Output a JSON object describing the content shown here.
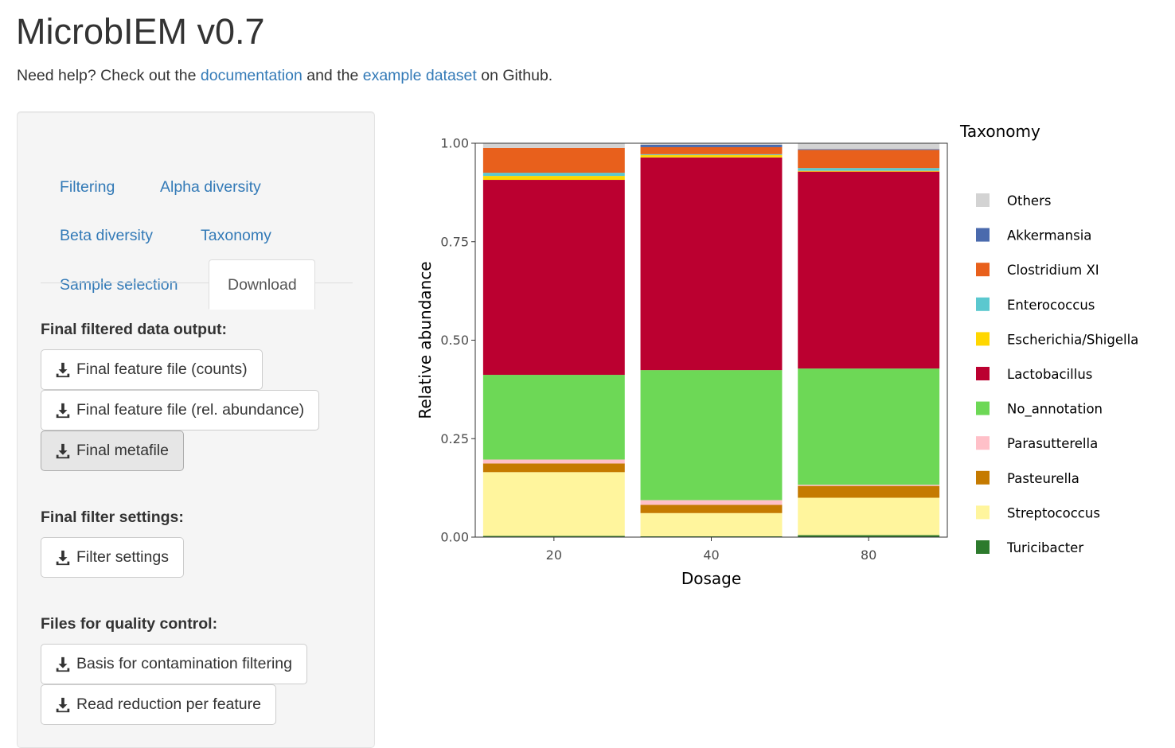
{
  "app": {
    "title": "MicrobIEM v0.7",
    "help_prefix": "Need help? Check out the ",
    "help_link1": "documentation",
    "help_mid": " and the ",
    "help_link2": "example dataset",
    "help_suffix": " on Github."
  },
  "tabs": [
    {
      "label": "Filtering"
    },
    {
      "label": "Alpha diversity"
    },
    {
      "label": "Beta diversity"
    },
    {
      "label": "Taxonomy"
    },
    {
      "label": "Sample selection"
    },
    {
      "label": "Download",
      "active": true
    }
  ],
  "download": {
    "section1_label": "Final filtered data output:",
    "btn_counts": "Final feature file (counts)",
    "btn_relabund": "Final feature file (rel. abundance)",
    "btn_metafile": "Final metafile",
    "section2_label": "Final filter settings:",
    "btn_filter_settings": "Filter settings",
    "section3_label": "Files for quality control:",
    "btn_contamination": "Basis for contamination filtering",
    "btn_read_reduction": "Read reduction per feature",
    "icon": "download-icon"
  },
  "chart_data": {
    "type": "bar",
    "stacked": true,
    "title": "",
    "xlabel": "Dosage",
    "ylabel": "Relative abundance",
    "ylim": [
      0,
      1
    ],
    "yticks": [
      "0.00",
      "0.25",
      "0.50",
      "0.75",
      "1.00"
    ],
    "categories": [
      "20",
      "40",
      "80"
    ],
    "legend_title": "Taxonomy",
    "legend_position": "right",
    "series": [
      {
        "name": "Turicibacter",
        "color": "#2d7a2d",
        "values": [
          0.003,
          0.002,
          0.005
        ]
      },
      {
        "name": "Streptococcus",
        "color": "#fff59d",
        "values": [
          0.162,
          0.059,
          0.095
        ]
      },
      {
        "name": "Pasteurella",
        "color": "#c57a00",
        "values": [
          0.022,
          0.021,
          0.03
        ]
      },
      {
        "name": "Parasutterella",
        "color": "#ffc0c8",
        "values": [
          0.01,
          0.012,
          0.003
        ]
      },
      {
        "name": "No_annotation",
        "color": "#6dd856",
        "values": [
          0.215,
          0.33,
          0.295
        ]
      },
      {
        "name": "Lactobacillus",
        "color": "#bb0030",
        "values": [
          0.495,
          0.54,
          0.5
        ]
      },
      {
        "name": "Escherichia/Shigella",
        "color": "#ffd700",
        "values": [
          0.01,
          0.006,
          0.002
        ]
      },
      {
        "name": "Enterococcus",
        "color": "#5bc8cf",
        "values": [
          0.008,
          0.002,
          0.007
        ]
      },
      {
        "name": "Clostridium XI",
        "color": "#e8601c",
        "values": [
          0.063,
          0.018,
          0.046
        ]
      },
      {
        "name": "Akkermansia",
        "color": "#4a6aad",
        "values": [
          0.0,
          0.006,
          0.002
        ]
      },
      {
        "name": "Others",
        "color": "#d3d3d3",
        "values": [
          0.012,
          0.004,
          0.015
        ]
      }
    ]
  }
}
